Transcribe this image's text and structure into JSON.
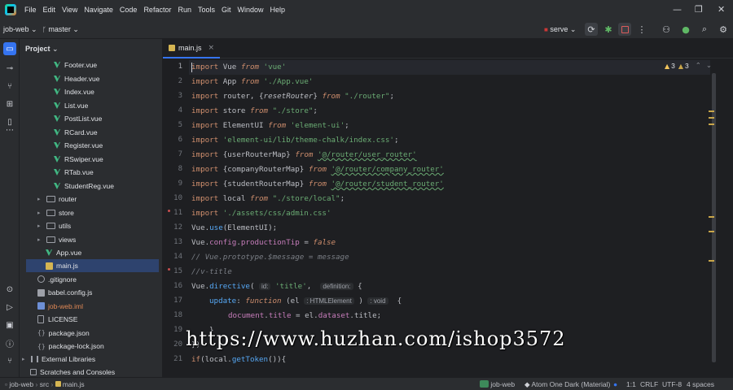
{
  "menubar": {
    "items": [
      "File",
      "Edit",
      "View",
      "Navigate",
      "Code",
      "Refactor",
      "Run",
      "Tools",
      "Git",
      "Window",
      "Help"
    ],
    "minimize": "—",
    "restore": "❐",
    "close": "✕"
  },
  "toolbar": {
    "project_name": "job-web",
    "branch": "master",
    "run_config": "serve"
  },
  "project_panel": {
    "title": "Project",
    "items": [
      {
        "label": "Footer.vue",
        "type": "vue"
      },
      {
        "label": "Header.vue",
        "type": "vue"
      },
      {
        "label": "Index.vue",
        "type": "vue"
      },
      {
        "label": "List.vue",
        "type": "vue"
      },
      {
        "label": "PostList.vue",
        "type": "vue"
      },
      {
        "label": "RCard.vue",
        "type": "vue"
      },
      {
        "label": "Register.vue",
        "type": "vue"
      },
      {
        "label": "RSwiper.vue",
        "type": "vue"
      },
      {
        "label": "RTab.vue",
        "type": "vue"
      },
      {
        "label": "StudentReg.vue",
        "type": "vue"
      },
      {
        "label": "router",
        "type": "folder"
      },
      {
        "label": "store",
        "type": "folder"
      },
      {
        "label": "utils",
        "type": "folder"
      },
      {
        "label": "views",
        "type": "folder"
      },
      {
        "label": "App.vue",
        "type": "vue"
      },
      {
        "label": "main.js",
        "type": "js"
      },
      {
        "label": ".gitignore",
        "type": "git"
      },
      {
        "label": "babel.config.js",
        "type": "js"
      },
      {
        "label": "job-web.iml",
        "type": "iml"
      },
      {
        "label": "LICENSE",
        "type": "file"
      },
      {
        "label": "package.json",
        "type": "json"
      },
      {
        "label": "package-lock.json",
        "type": "json"
      },
      {
        "label": "External Libraries",
        "type": "lib"
      },
      {
        "label": "Scratches and Consoles",
        "type": "scratch"
      }
    ]
  },
  "editor": {
    "tab_label": "main.js",
    "tab_close": "×",
    "warnings": "3",
    "weak_warnings": "3",
    "line_numbers": [
      "1",
      "2",
      "3",
      "4",
      "5",
      "6",
      "7",
      "8",
      "9",
      "10",
      "11",
      "12",
      "13",
      "14",
      "15",
      "16",
      "17",
      "18",
      "19",
      "20",
      "21"
    ],
    "code": {
      "l1_kw": "import",
      "l1_id": " Vue ",
      "l1_from": "from",
      "l1_str": " 'vue'",
      "l2_kw": "import",
      "l2_id": " App ",
      "l2_from": "from",
      "l2_str": " './App.vue'",
      "l3_kw": "import",
      "l3_id": " router, {",
      "l3_it": "resetRouter",
      "l3_id2": "} ",
      "l3_from": "from",
      "l3_str": " \"./router\"",
      "l3_end": ";",
      "l4_kw": "import",
      "l4_id": " store ",
      "l4_from": "from",
      "l4_str": " \"./store\"",
      "l4_end": ";",
      "l5_kw": "import",
      "l5_id": " ElementUI ",
      "l5_from": "from",
      "l5_str": " 'element-ui'",
      "l5_end": ";",
      "l6_kw": "import",
      "l6_str": " 'element-ui/lib/theme-chalk/index.css'",
      "l6_end": ";",
      "l7_kw": "import",
      "l7_id": " {userRouterMap} ",
      "l7_from": "from",
      "l7_str": "'@/router/user_router'",
      "l8_kw": "import",
      "l8_id": " {companyRouterMap} ",
      "l8_from": "from",
      "l8_str": "'@/router/company_router'",
      "l9_kw": "import",
      "l9_id": " {studentRouterMap} ",
      "l9_from": "from",
      "l9_str": "'@/router/student_router'",
      "l10_kw": "import",
      "l10_id": " local ",
      "l10_from": "from",
      "l10_str": " \"./store/local\"",
      "l10_end": ";",
      "l11_kw": "import",
      "l11_str": " './assets/css/admin.css'",
      "l12_id": "Vue.",
      "l12_fn": "use",
      "l12_end": "(ElementUI);",
      "l13_id": "Vue.",
      "l13_prop": "config",
      "l13_dot": ".",
      "l13_prop2": "productionTip",
      "l13_eq": " = ",
      "l13_kw": "false",
      "l14_cmt": "// Vue.prototype.$message = message",
      "l15_cmt": "//v-title",
      "l16_id": "Vue.",
      "l16_fn": "directive",
      "l16_p": "( ",
      "l16_hint1": "id:",
      "l16_str": " 'title'",
      "l16_c": ",  ",
      "l16_hint2": "definition:",
      "l16_end": " {",
      "l17_fn": "update",
      "l17_c": ": ",
      "l17_kw": "function",
      "l17_p": " (el ",
      "l17_hint": ": HTMLElement",
      "l17_p2": " ) ",
      "l17_hint2": ": void",
      "l17_end": "  {",
      "l18_prop": "document",
      "l18_dot": ".",
      "l18_prop2": "title",
      "l18_eq": " = el.",
      "l18_prop3": "dataset",
      "l18_end": ".title;",
      "l19": "}",
      "l20": "})",
      "l21_kw": "if",
      "l21_rest": "(local.",
      "l21_fn": "getToken",
      "l21_end": "()){"
    }
  },
  "watermark": "https://www.huzhan.com/ishop3572",
  "statusbar": {
    "breadcrumb": [
      "job-web",
      "src",
      "main.js"
    ],
    "plugin": "job-web",
    "theme": "Atom One Dark (Material)",
    "position": "1:1",
    "line_sep": "CRLF",
    "encoding": "UTF-8",
    "indent": "4 spaces"
  },
  "colors": {
    "accent": "#3574f0",
    "vue_green": "#41b883",
    "keyword": "#cf8e6d",
    "string": "#6aab73",
    "function": "#56a8f5",
    "property": "#c77dbb"
  }
}
